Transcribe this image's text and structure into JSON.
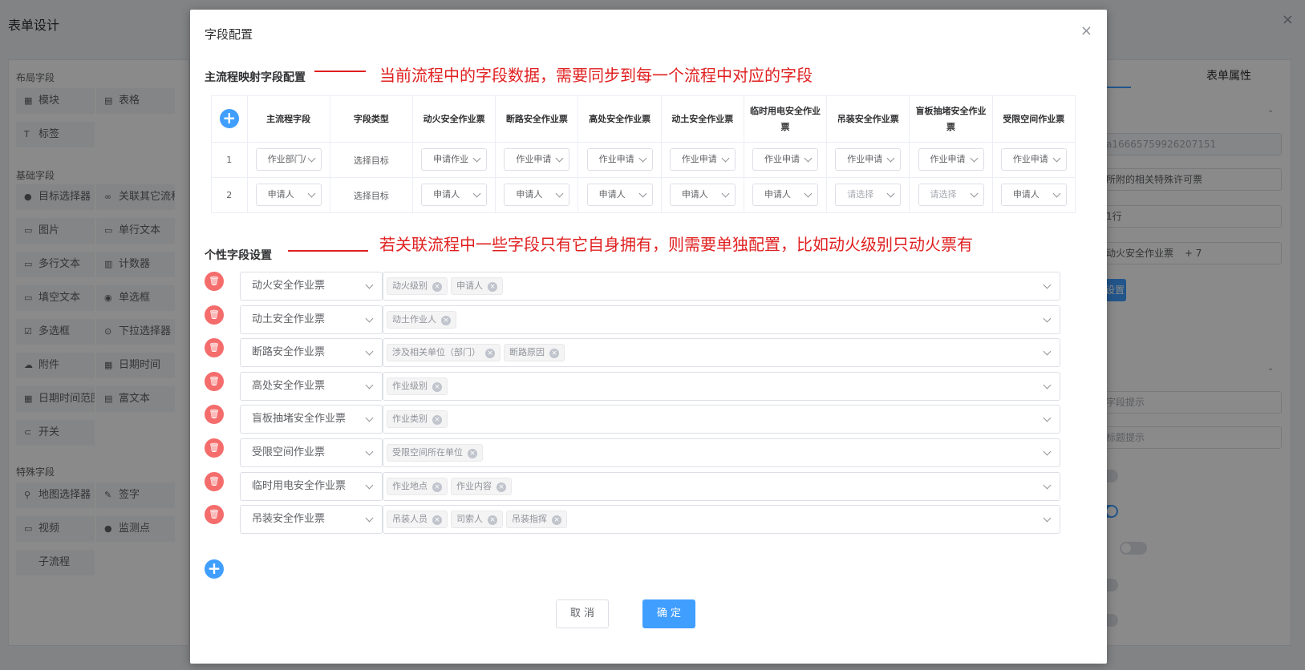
{
  "background": {
    "page_title": "表单设计",
    "close_icon": "×",
    "groups": [
      {
        "label": "布局字段"
      },
      {
        "label": "基础字段"
      },
      {
        "label": "特殊字段"
      }
    ],
    "items": [
      {
        "label": "模块",
        "icon": "▦"
      },
      {
        "label": "表格",
        "icon": "▤"
      },
      {
        "label": "标签",
        "icon": "T"
      },
      {
        "label": "目标选择器",
        "icon": "●"
      },
      {
        "label": "关联其它流程",
        "icon": "∞"
      },
      {
        "label": "图片",
        "icon": "▭"
      },
      {
        "label": "单行文本",
        "icon": "▭"
      },
      {
        "label": "多行文本",
        "icon": "▭"
      },
      {
        "label": "计数器",
        "icon": "▥"
      },
      {
        "label": "填空文本",
        "icon": "▭"
      },
      {
        "label": "单选框",
        "icon": "◉"
      },
      {
        "label": "多选框",
        "icon": "☑"
      },
      {
        "label": "下拉选择器",
        "icon": "⊙"
      },
      {
        "label": "附件",
        "icon": "☁"
      },
      {
        "label": "日期时间",
        "icon": "▦"
      },
      {
        "label": "日期时间范围",
        "icon": "▦"
      },
      {
        "label": "富文本",
        "icon": "▤"
      },
      {
        "label": "开关",
        "icon": "⊂"
      },
      {
        "label": "地图选择器",
        "icon": "⚲"
      },
      {
        "label": "签字",
        "icon": "✎"
      },
      {
        "label": "视频",
        "icon": "▭"
      },
      {
        "label": "监测点",
        "icon": "●"
      },
      {
        "label": "子流程",
        "icon": ""
      }
    ],
    "right_tab": "表单属性",
    "right_inputs": {
      "id_value": "a16665759926207151",
      "desc_value": "所附的相关特殊许可票",
      "layout_value": "1行",
      "linked_tag": "动火安全作业票",
      "linked_more": "+ 7",
      "button_label": "设置",
      "placeholder_1": "字段提示",
      "placeholder_2": "标题提示"
    }
  },
  "dialog": {
    "title": "字段配置",
    "close_icon": "×",
    "mapping_section_title": "主流程映射字段配置",
    "mapping_annotation": "当前流程中的字段数据，需要同步到每一个流程中对应的字段",
    "custom_section_title": "个性字段设置",
    "custom_annotation": "若关联流程中一些字段只有它自身拥有，则需要单独配置，比如动火级别只动火票有",
    "add_icon": "+",
    "delete_icon": "🗑",
    "table": {
      "headers": [
        "主流程字段",
        "字段类型",
        "动火安全作业票",
        "断路安全作业票",
        "高处安全作业票",
        "动土安全作业票",
        "临时用电安全作业票",
        "吊装安全作业票",
        "盲板抽堵安全作业票",
        "受限空间作业票"
      ],
      "rows": [
        {
          "index": "1",
          "main_field": "作业部门/",
          "type": "选择目标",
          "cells": [
            "申请作业",
            "作业申请",
            "作业申请",
            "作业申请",
            "作业申请",
            "作业申请",
            "作业申请",
            "作业申请"
          ]
        },
        {
          "index": "2",
          "main_field": "申请人",
          "type": "选择目标",
          "cells": [
            "申请人",
            "申请人",
            "申请人",
            "申请人",
            "申请人",
            "请选择",
            "请选择",
            "申请人"
          ]
        }
      ]
    },
    "custom_rows": [
      {
        "form": "动火安全作业票",
        "tags": [
          "动火级别",
          "申请人"
        ]
      },
      {
        "form": "动土安全作业票",
        "tags": [
          "动土作业人"
        ]
      },
      {
        "form": "断路安全作业票",
        "tags": [
          "涉及相关单位（部门）",
          "断路原因"
        ]
      },
      {
        "form": "高处安全作业票",
        "tags": [
          "作业级别"
        ]
      },
      {
        "form": "盲板抽堵安全作业票",
        "tags": [
          "作业类别"
        ]
      },
      {
        "form": "受限空间作业票",
        "tags": [
          "受限空间所在单位"
        ]
      },
      {
        "form": "临时用电安全作业票",
        "tags": [
          "作业地点",
          "作业内容"
        ]
      },
      {
        "form": "吊装安全作业票",
        "tags": [
          "吊装人员",
          "司索人",
          "吊装指挥"
        ]
      }
    ],
    "cancel_label": "取 消",
    "ok_label": "确 定"
  }
}
